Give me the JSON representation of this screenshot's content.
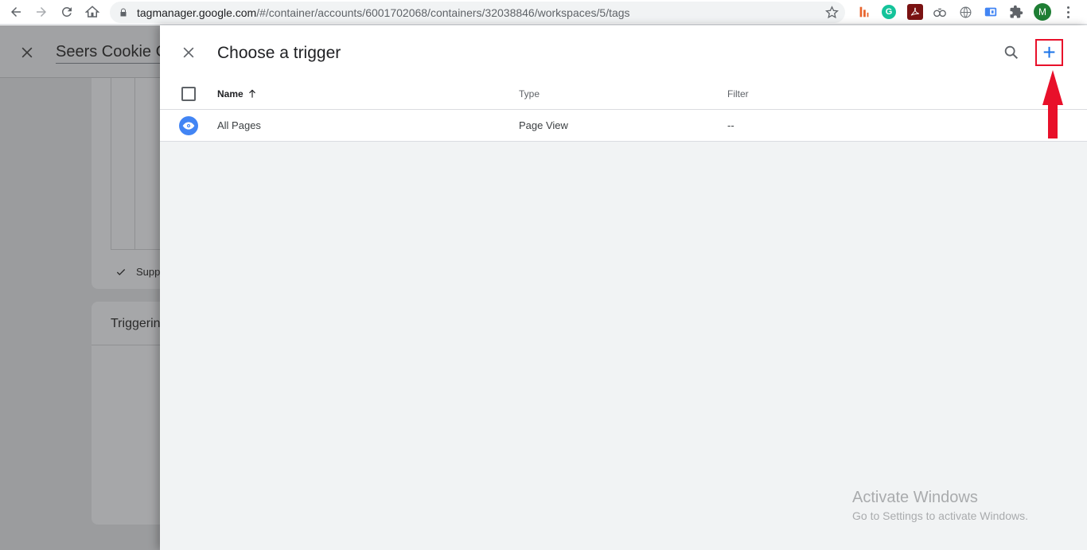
{
  "browser": {
    "url_host": "tagmanager.google.com",
    "url_path": "/#/container/accounts/6001702068/containers/32038846/workspaces/5/tags",
    "profile_initial": "M",
    "extensions": [
      "bar-chart-icon",
      "grammarly-icon",
      "acrobat-icon",
      "link-extension-icon",
      "globe-icon",
      "translate-icon",
      "puzzle-icon"
    ]
  },
  "background_page": {
    "title": "Seers Cookie C",
    "support_label": "Supp",
    "triggering_label": "Triggerin"
  },
  "panel": {
    "title": "Choose a trigger",
    "columns": {
      "name": "Name",
      "type": "Type",
      "filter": "Filter"
    },
    "rows": [
      {
        "name": "All Pages",
        "type": "Page View",
        "filter": "--"
      }
    ]
  },
  "watermark": {
    "line1": "Activate Windows",
    "line2": "Go to Settings to activate Windows."
  },
  "colors": {
    "accent_blue": "#1a73e8",
    "annotation_red": "#e8102a",
    "trigger_icon_blue": "#4285f4"
  }
}
